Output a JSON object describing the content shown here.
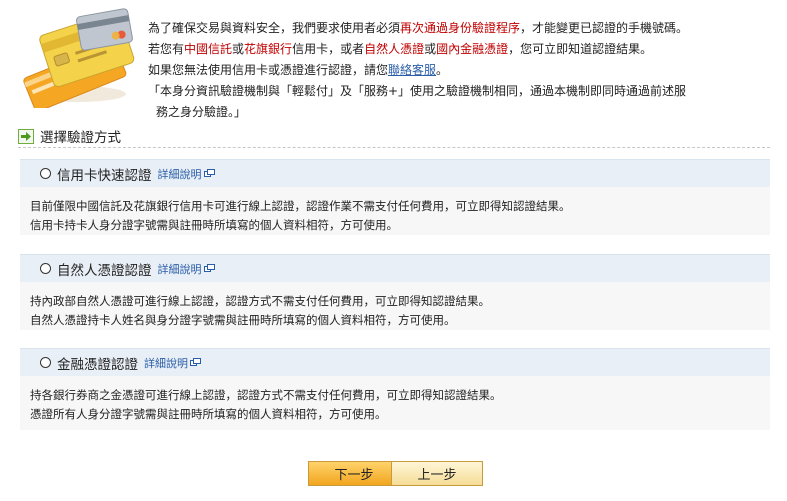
{
  "intro": {
    "line1_pre": "為了確保交易與資料安全，我們要求使用者必須",
    "line1_red": "再次通過身份驗證程序",
    "line1_post": "，才能變更已認證的手機號碼。",
    "line2_a": "若您有",
    "line2_red1": "中國信託",
    "line2_b": "或",
    "line2_red2": "花旗銀行",
    "line2_c": "信用卡，或者",
    "line2_red3": "自然人憑證",
    "line2_d": "或",
    "line2_red4": "國內金融憑證",
    "line2_e": "，您可立即知道認證結果。",
    "line3_pre": "如果您無法使用信用卡或憑證進行認證，請您",
    "line3_link": "聯絡客服",
    "line3_post": "。",
    "line4": "「本身分資訊驗證機制與「輕鬆付」及「服務+」使用之驗證機制相同，通過本機制即同時通過前述服",
    "line5": "務之身分驗證。」"
  },
  "section_title": "選擇驗證方式",
  "detail_label": "詳細說明",
  "options": [
    {
      "title": "信用卡快速認證",
      "line1": "目前僅限中國信託及花旗銀行信用卡可進行線上認證，認證作業不需支付任何費用，可立即得知認證結果。",
      "line2": "信用卡持卡人身分證字號需與註冊時所填寫的個人資料相符，方可使用。"
    },
    {
      "title": "自然人憑證認證",
      "line1": "持內政部自然人憑證可進行線上認證，認證方式不需支付任何費用，可立即得知認證結果。",
      "line2": "自然人憑證持卡人姓名與身分證字號需與註冊時所填寫的個人資料相符，方可使用。"
    },
    {
      "title": "金融憑證認證",
      "line1": "持各銀行券商之金憑證可進行線上認證，認證方式不需支付任何費用，可立即得知認證結果。",
      "line2": "憑證所有人身分證字號需與註冊時所填寫的個人資料相符，方可使用。"
    }
  ],
  "buttons": {
    "next": "下一步",
    "prev": "上一步"
  },
  "colors": {
    "highlight_red": "#c00000",
    "link_blue": "#2a5da8",
    "header_bg": "#e8eff6",
    "next_button": "#f2a51f"
  },
  "icons": {
    "hero": "id-cards-illustration",
    "section": "green-arrow-icon",
    "popup": "new-window-icon"
  }
}
